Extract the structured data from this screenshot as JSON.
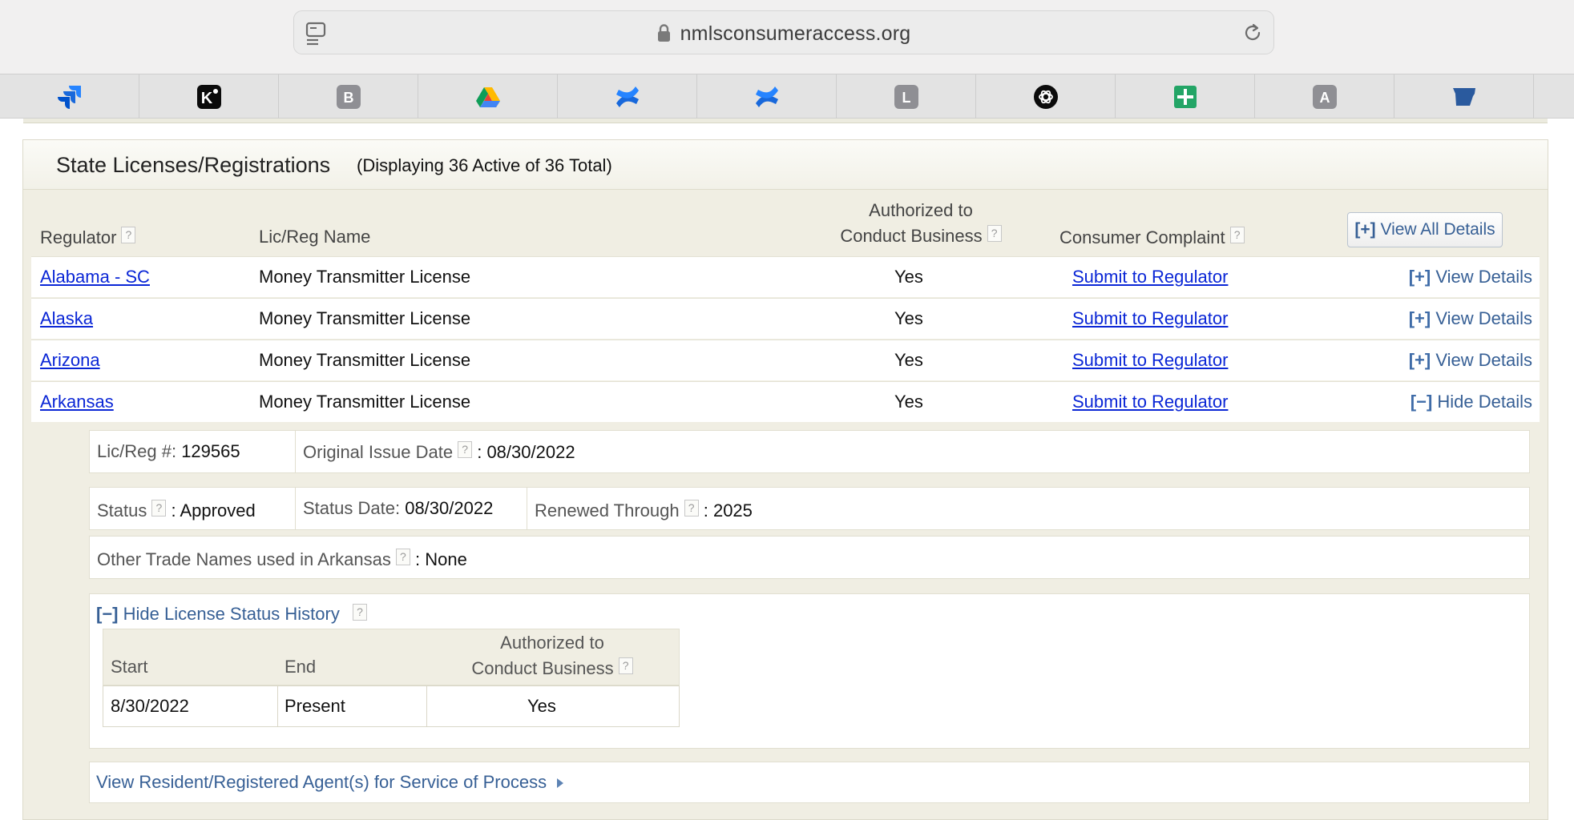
{
  "browser": {
    "url": "nmlsconsumeraccess.org",
    "icons": {
      "reader": "reader-icon",
      "lock": "lock-icon",
      "reload": "reload-icon"
    },
    "bookmarks": [
      {
        "name": "jira-icon"
      },
      {
        "name": "k-app-icon",
        "glyph": "K"
      },
      {
        "name": "b-icon",
        "glyph": "B"
      },
      {
        "name": "google-drive-icon"
      },
      {
        "name": "confluence-icon"
      },
      {
        "name": "confluence-icon"
      },
      {
        "name": "l-icon",
        "glyph": "L"
      },
      {
        "name": "openai-icon"
      },
      {
        "name": "google-sheets-icon"
      },
      {
        "name": "a-icon",
        "glyph": "A"
      },
      {
        "name": "arkansas-shape-icon"
      }
    ]
  },
  "section": {
    "title": "State Licenses/Registrations",
    "count": "(Displaying 36 Active of 36 Total)"
  },
  "table": {
    "headers": {
      "regulator": "Regulator",
      "name": "Lic/Reg Name",
      "authorized_line1": "Authorized to",
      "authorized_line2": "Conduct Business",
      "complaint": "Consumer Complaint"
    },
    "help_mark": "?",
    "view_all": {
      "bracket": "[+]",
      "label": "View All Details"
    },
    "rows": [
      {
        "regulator": "Alabama - SC",
        "name": "Money Transmitter License",
        "authorized": "Yes",
        "complaint": "Submit to Regulator",
        "toggle": "[+]",
        "details": "View Details"
      },
      {
        "regulator": "Alaska",
        "name": "Money Transmitter License",
        "authorized": "Yes",
        "complaint": "Submit to Regulator",
        "toggle": "[+]",
        "details": "View Details"
      },
      {
        "regulator": "Arizona",
        "name": "Money Transmitter License",
        "authorized": "Yes",
        "complaint": "Submit to Regulator",
        "toggle": "[+]",
        "details": "View Details"
      },
      {
        "regulator": "Arkansas",
        "name": "Money Transmitter License",
        "authorized": "Yes",
        "complaint": "Submit to Regulator",
        "toggle": "[−]",
        "details": "Hide Details"
      }
    ]
  },
  "details": {
    "lic_label": "Lic/Reg #:",
    "lic_value": "129565",
    "orig_label": "Original Issue Date",
    "orig_value": ": 08/30/2022",
    "status_label": "Status",
    "status_value": ": Approved",
    "status_date_label": "Status Date:",
    "status_date_value": "08/30/2022",
    "renewed_label": "Renewed Through",
    "renewed_value": ": 2025",
    "trade_label": "Other Trade Names used in Arkansas",
    "trade_value": ": None",
    "history": {
      "toggle": "[−]",
      "label": "Hide License Status History",
      "headers": {
        "start": "Start",
        "end": "End",
        "auth_line1": "Authorized to",
        "auth_line2": "Conduct Business"
      },
      "rows": [
        {
          "start": "8/30/2022",
          "end": "Present",
          "authorized": "Yes"
        }
      ]
    },
    "agent_link": "View Resident/Registered Agent(s) for Service of Process"
  },
  "colors": {
    "link": "#0a26d6",
    "action": "#365f95",
    "panel_bg": "#f0eee3"
  }
}
